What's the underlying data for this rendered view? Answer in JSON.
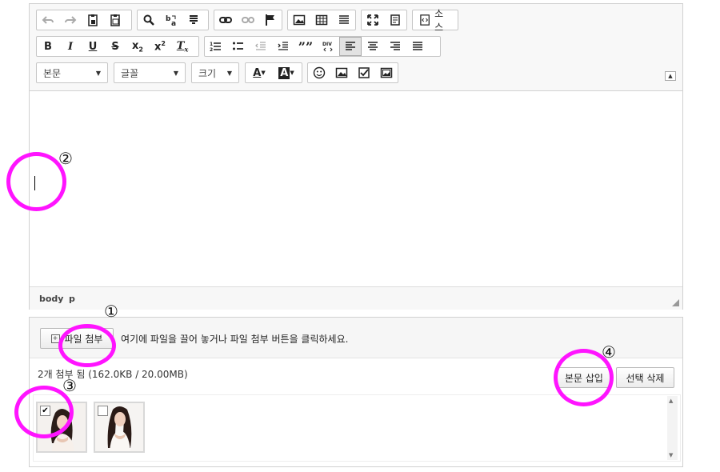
{
  "toolbar": {
    "source_label": "소스",
    "combo_format": "본문",
    "combo_font": "글꼴",
    "combo_size": "크기",
    "groups": [
      [
        "undo-icon",
        "redo-icon",
        "paste-icon",
        "paste-text-icon"
      ],
      [
        "find-icon",
        "replace-icon",
        "select-all-icon"
      ],
      [
        "link-icon",
        "unlink-icon",
        "anchor-icon"
      ],
      [
        "image-icon",
        "table-icon",
        "horizontal-line-icon"
      ],
      [
        "maximize-icon",
        "show-blocks-icon"
      ]
    ]
  },
  "pathbar": {
    "body": "body",
    "p": "p"
  },
  "attach": {
    "attach_button": "파일 첨부",
    "hint": "여기에 파일을 끌어 놓거나 파일 첨부 버튼을 클릭하세요.",
    "count": "2개 첨부 됨 (162.0KB / 20.00MB)",
    "insert_button": "본문 삽입",
    "delete_button": "선택 삭제",
    "files": [
      {
        "checked": true
      },
      {
        "checked": false
      }
    ]
  },
  "annotations": [
    {
      "label": "①",
      "color": "#ff14ff"
    },
    {
      "label": "②",
      "color": "#ff14ff"
    },
    {
      "label": "③",
      "color": "#ff14ff"
    },
    {
      "label": "④",
      "color": "#ff14ff"
    }
  ]
}
